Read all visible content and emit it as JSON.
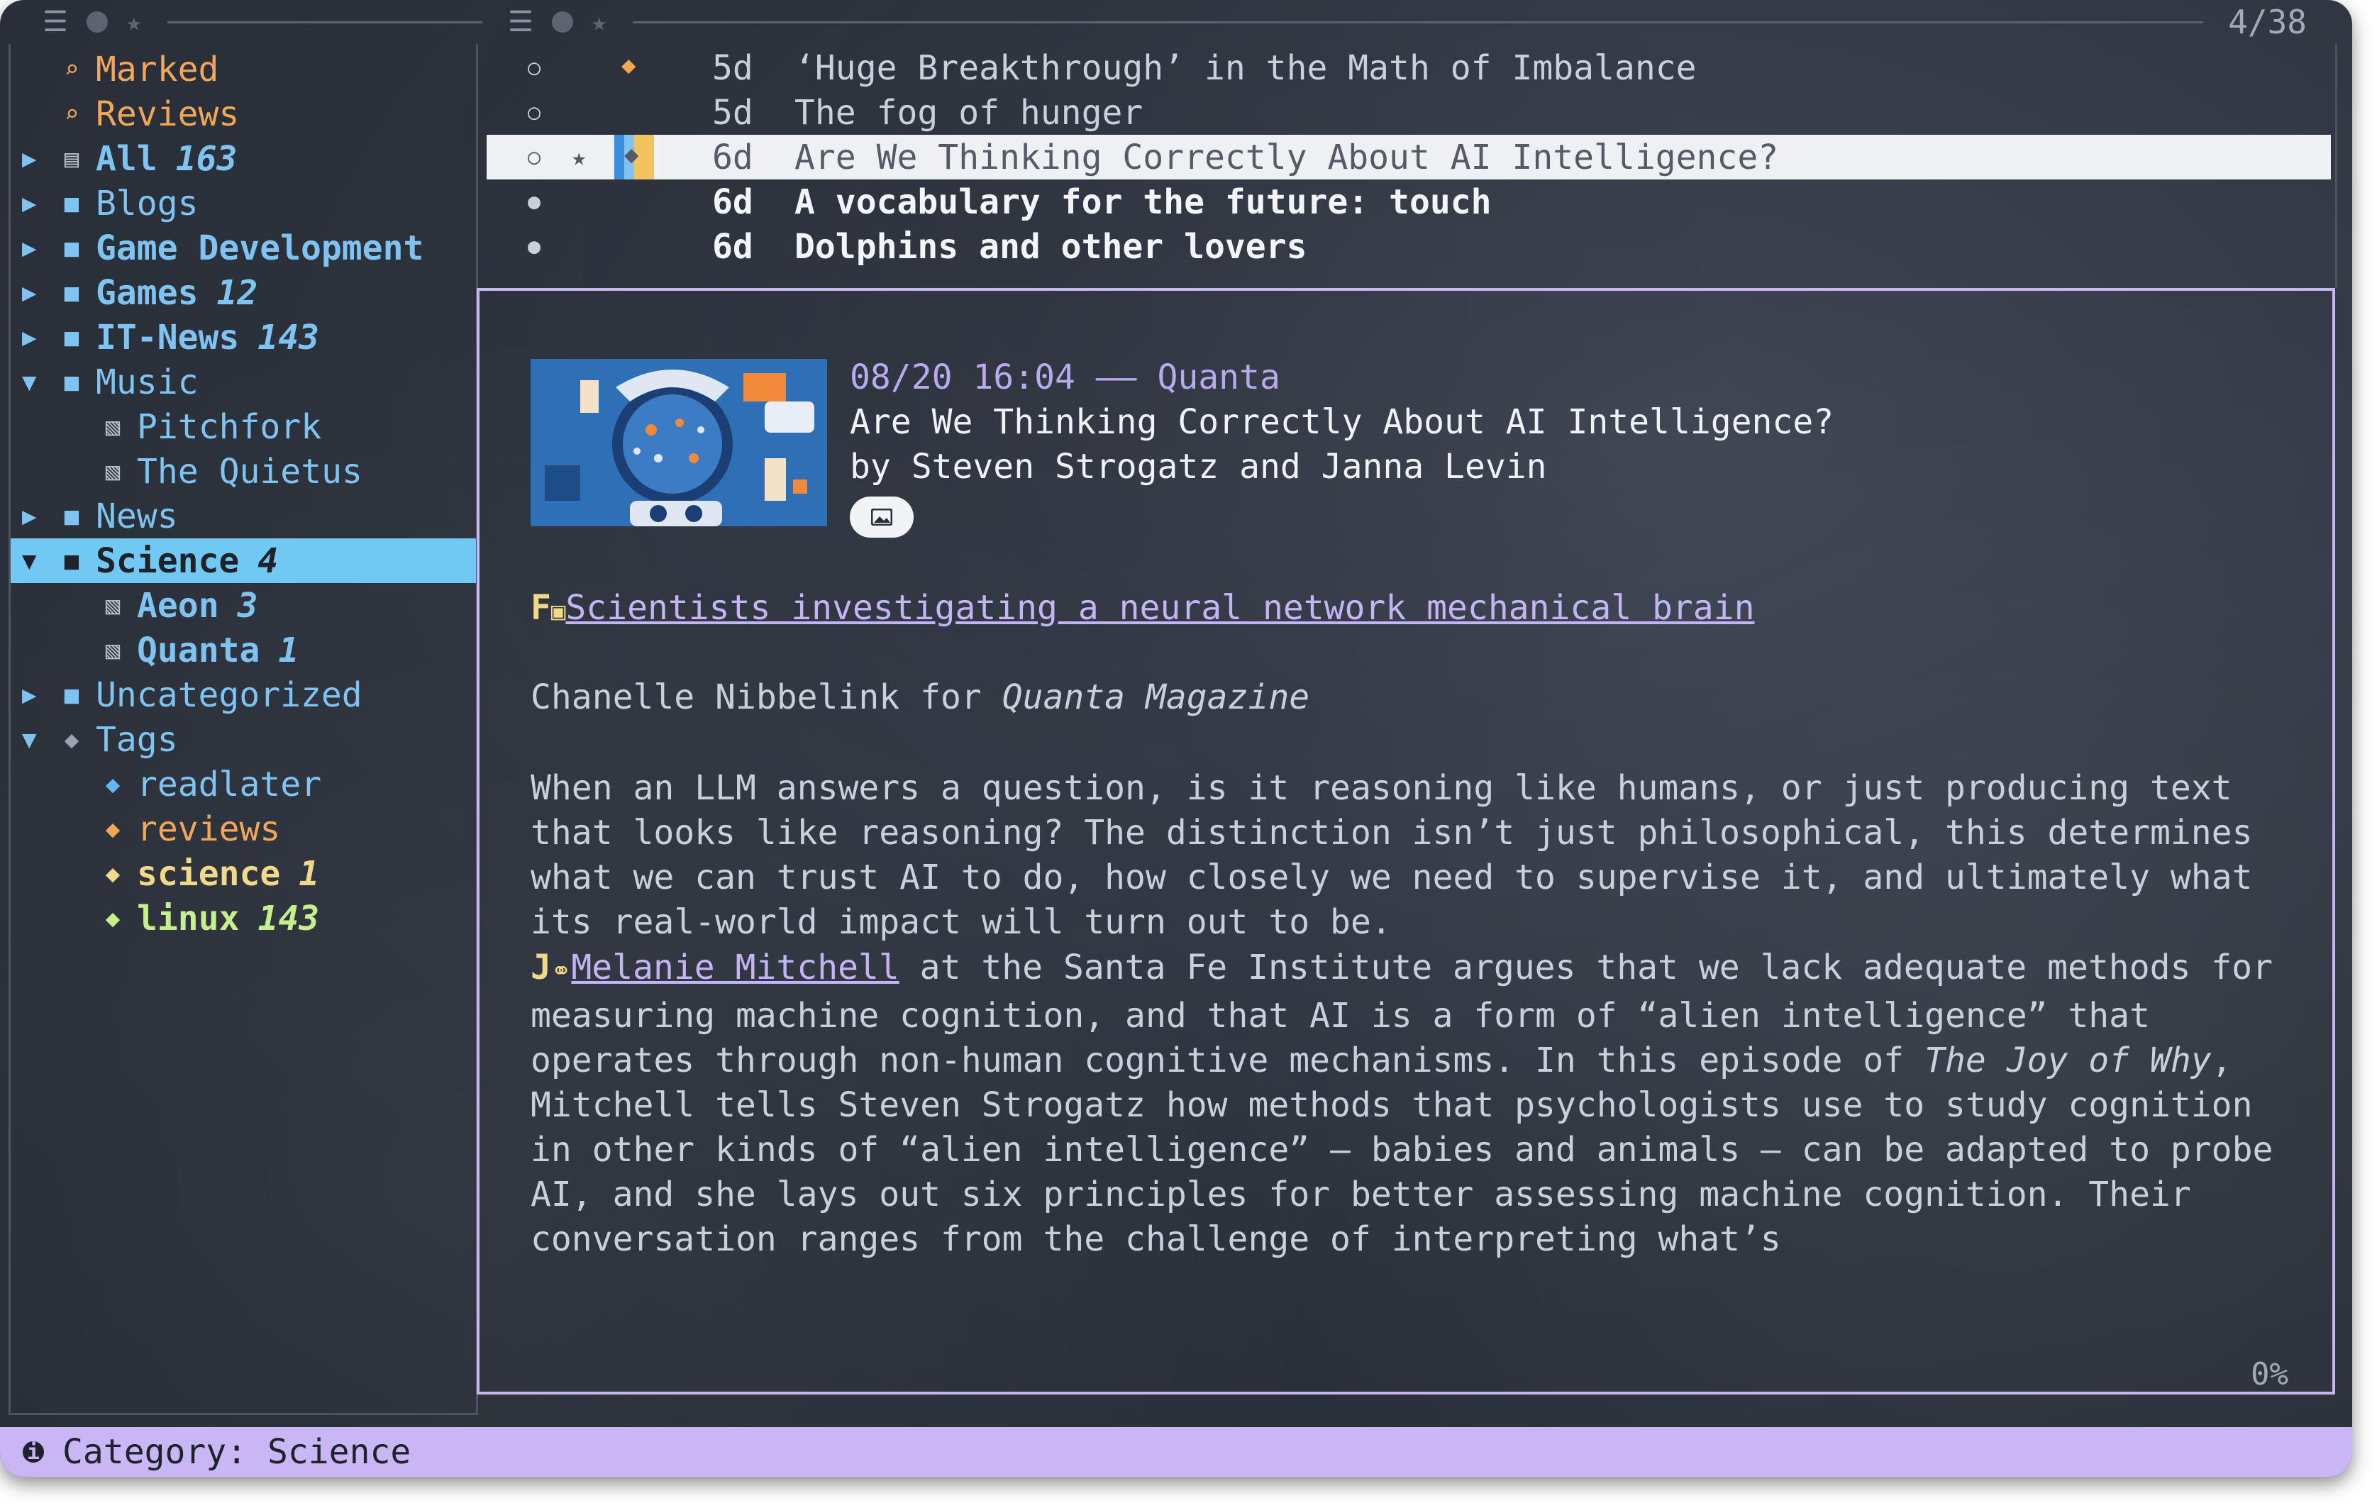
{
  "header": {
    "menu_icon": "hamburger-icon",
    "counter": "4/38"
  },
  "sidebar": {
    "items": [
      {
        "label": "Marked",
        "count": "",
        "icon": "search-icon",
        "color": "#f2a65a",
        "bold": false,
        "arrow": ""
      },
      {
        "label": "Reviews",
        "count": "",
        "icon": "search-icon",
        "color": "#f2a65a",
        "bold": false,
        "arrow": ""
      },
      {
        "label": "All",
        "count": "163",
        "icon": "feed-icon",
        "color": "#7ec3f1",
        "bold": true,
        "arrow": "▶"
      },
      {
        "label": "Blogs",
        "count": "",
        "icon": "folder-icon",
        "color": "#7ec3f1",
        "bold": false,
        "arrow": "▶"
      },
      {
        "label": "Game Development",
        "count": "",
        "icon": "folder-icon",
        "color": "#7ec3f1",
        "bold": true,
        "arrow": "▶"
      },
      {
        "label": "Games",
        "count": "12",
        "icon": "folder-icon",
        "color": "#7ec3f1",
        "bold": true,
        "arrow": "▶"
      },
      {
        "label": "IT-News",
        "count": "143",
        "icon": "folder-icon",
        "color": "#7ec3f1",
        "bold": true,
        "arrow": "▶"
      },
      {
        "label": "Music",
        "count": "",
        "icon": "folder-icon",
        "color": "#7ec3f1",
        "bold": false,
        "arrow": "▼"
      },
      {
        "label": "Pitchfork",
        "count": "",
        "icon": "rss-icon",
        "color": "#7ec3f1",
        "bold": false,
        "arrow": "",
        "indent": true
      },
      {
        "label": "The Quietus",
        "count": "",
        "icon": "rss-icon",
        "color": "#7ec3f1",
        "bold": false,
        "arrow": "",
        "indent": true
      },
      {
        "label": "News",
        "count": "",
        "icon": "folder-icon",
        "color": "#7ec3f1",
        "bold": false,
        "arrow": "▶"
      },
      {
        "label": "Science",
        "count": "4",
        "icon": "folder-icon",
        "color": "#1d222b",
        "bold": true,
        "arrow": "▼",
        "selected": true
      },
      {
        "label": "Aeon",
        "count": "3",
        "icon": "rss-icon",
        "color": "#7ec3f1",
        "bold": true,
        "arrow": "",
        "indent": true
      },
      {
        "label": "Quanta",
        "count": "1",
        "icon": "rss-icon",
        "color": "#7ec3f1",
        "bold": true,
        "arrow": "",
        "indent": true
      },
      {
        "label": "Uncategorized",
        "count": "",
        "icon": "folder-icon",
        "color": "#7ec3f1",
        "bold": false,
        "arrow": "▶"
      },
      {
        "label": "Tags",
        "count": "",
        "icon": "tags-icon",
        "color": "#7ec3f1",
        "bold": false,
        "arrow": "▼"
      },
      {
        "label": "readlater",
        "count": "",
        "icon": "tag-icon",
        "color": "#7ec3f1",
        "bold": false,
        "arrow": "",
        "indent": true,
        "tagcolor": "#63b6ef"
      },
      {
        "label": "reviews",
        "count": "",
        "icon": "tag-icon",
        "color": "#f2a65a",
        "bold": false,
        "arrow": "",
        "indent": true,
        "tagcolor": "#f2a65a"
      },
      {
        "label": "science",
        "count": "1",
        "icon": "tag-icon",
        "color": "#f1d98a",
        "bold": true,
        "arrow": "",
        "indent": true,
        "tagcolor": "#f1d98a"
      },
      {
        "label": "linux",
        "count": "143",
        "icon": "tag-icon",
        "color": "#c6ef8e",
        "bold": true,
        "arrow": "",
        "indent": true,
        "tagcolor": "#c6ef8e"
      }
    ]
  },
  "articles": [
    {
      "read": true,
      "marked": false,
      "tag": "#f2a65a",
      "age": "5d",
      "title": "‘Huge Breakthrough’ in the Math of Imbalance",
      "bold": false,
      "selected": false
    },
    {
      "read": true,
      "marked": false,
      "tag": "",
      "age": "5d",
      "title": "The fog of hunger",
      "bold": false,
      "selected": false
    },
    {
      "read": true,
      "marked": true,
      "tag": "multi",
      "age": "6d",
      "title": "Are We Thinking Correctly About AI Intelligence?",
      "bold": false,
      "selected": true
    },
    {
      "read": false,
      "marked": false,
      "tag": "",
      "age": "6d",
      "title": "A vocabulary for the future: touch",
      "bold": true,
      "selected": false
    },
    {
      "read": false,
      "marked": false,
      "tag": "",
      "age": "6d",
      "title": "Dolphins and other lovers",
      "bold": true,
      "selected": false
    }
  ],
  "preview": {
    "date_line": "08/20 16:04 —— Quanta",
    "title": "Are We Thinking Correctly About AI Intelligence?",
    "byline": "by Steven Strogatz and Janna Levin",
    "figure_marker": "F",
    "figure_link": "Scientists investigating a neural network mechanical brain",
    "credit_prefix": "Chanelle Nibbelink for ",
    "credit_magazine": "Quanta Magazine",
    "para1": "When an LLM answers a question, is it reasoning like humans, or just producing text that looks like reasoning? The distinction isn’t just philosophical, this determines what we can trust AI to do, how closely we need to supervise it, and ultimately what its real-world impact will turn out to be.",
    "link_marker": "J",
    "person_link": "Melanie Mitchell",
    "para2_a": " at the Santa Fe Institute argues that we lack adequate methods for measuring machine cognition, and that AI is a form of “alien intelligence” that operates through non-human cognitive mechanisms. In this episode of ",
    "para2_italic": "The Joy of Why",
    "para2_b": ", Mitchell tells Steven Strogatz how methods that psychologists use to study cognition in other kinds of “alien intelligence” — babies and animals — can be adapted to probe AI, and she lays out six principles for better assessing machine cognition. Their conversation ranges from the challenge of interpreting what’s",
    "scroll_percent": "0%"
  },
  "status": {
    "text": "Category: Science"
  }
}
